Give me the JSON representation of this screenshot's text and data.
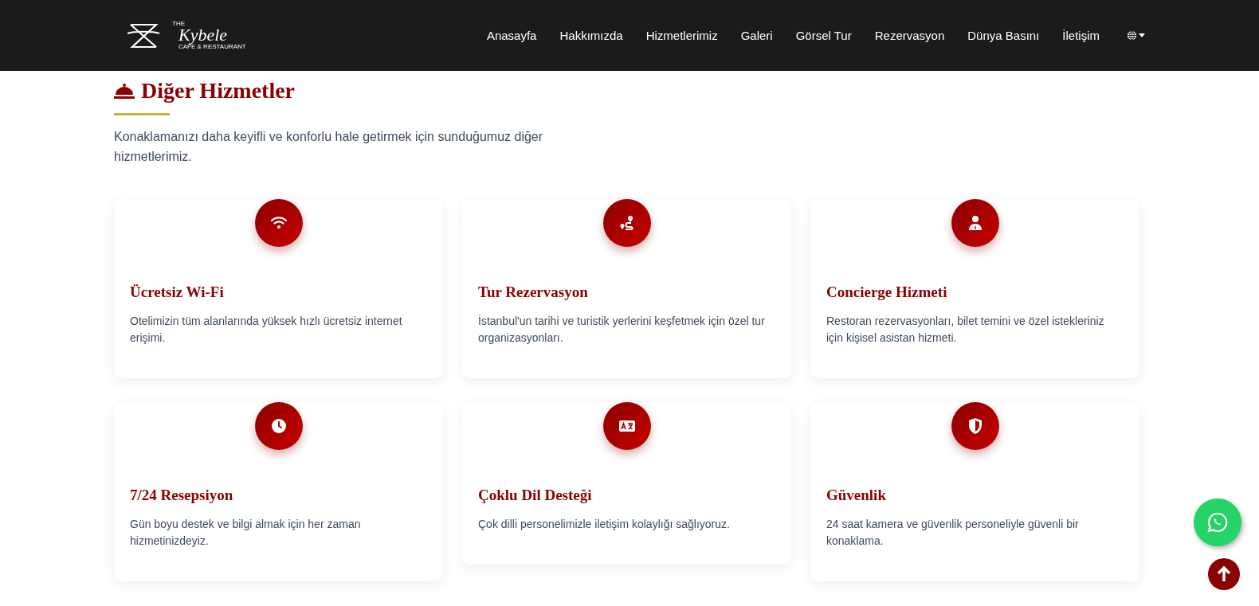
{
  "header": {
    "logo": {
      "small": "THE",
      "name": "Kybele",
      "tagline": "CAFE & RESTAURANT"
    },
    "nav": [
      {
        "label": "Anasayfa"
      },
      {
        "label": "Hakkımızda"
      },
      {
        "label": "Hizmetlerimiz"
      },
      {
        "label": "Galeri"
      },
      {
        "label": "Görsel Tur"
      },
      {
        "label": "Rezervasyon"
      },
      {
        "label": "Dünya Basını"
      },
      {
        "label": "İletişim"
      }
    ]
  },
  "section": {
    "title": "Diğer Hizmetler",
    "intro": "Konaklamanızı daha keyifli ve konforlu hale getirmek için sunduğumuz diğer hizmetlerimiz.",
    "cards": [
      {
        "kind": "wifi",
        "title": "Ücretsiz Wi-Fi",
        "text": "Otelimizin tüm alanlarında yüksek hızlı ücretsiz internet erişimi."
      },
      {
        "kind": "route",
        "title": "Tur Rezervasyon",
        "text": "İstanbul'un tarihi ve turistik yerlerini keşfetmek için özel tur organizasyonları."
      },
      {
        "kind": "person",
        "title": "Concierge Hizmeti",
        "text": "Restoran rezervasyonları, bilet temini ve özel istekleriniz için kişisel asistan hizmeti."
      },
      {
        "kind": "clock",
        "title": "7/24 Resepsiyon",
        "text": "Gün boyu destek ve bilgi almak için her zaman hizmetinizdeyiz."
      },
      {
        "kind": "language",
        "title": "Çoklu Dil Desteği",
        "text": "Çok dilli personelimizle iletişim kolaylığı sağlıyoruz."
      },
      {
        "kind": "shield",
        "title": "Güvenlik",
        "text": "24 saat kamera ve güvenlik personeliyle güvenli bir konaklama."
      }
    ]
  }
}
